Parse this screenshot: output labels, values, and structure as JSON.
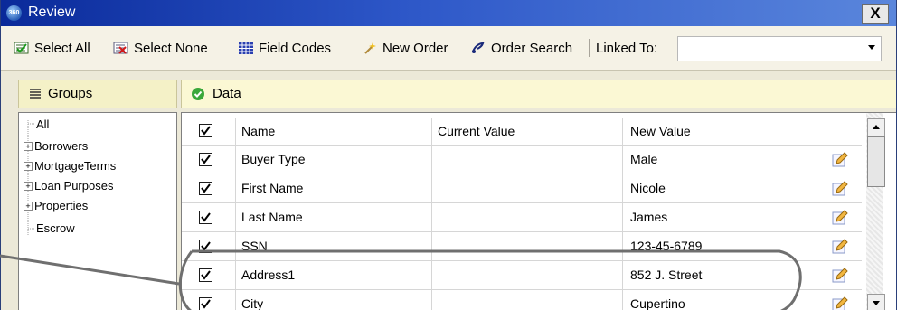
{
  "window": {
    "title": "Review",
    "close_label": "X",
    "app_icon": "360-logo-icon",
    "app_icon_text": "360"
  },
  "toolbar": {
    "select_all": "Select All",
    "select_none": "Select None",
    "field_codes": "Field Codes",
    "new_order": "New Order",
    "order_search": "Order Search",
    "linked_to": "Linked To:",
    "linked_to_value": ""
  },
  "groups": {
    "label": "Groups",
    "items": [
      {
        "label": "All",
        "expandable": false
      },
      {
        "label": "Borrowers",
        "expandable": true
      },
      {
        "label": "MortgageTerms",
        "expandable": true
      },
      {
        "label": "Loan Purposes",
        "expandable": true
      },
      {
        "label": "Properties",
        "expandable": true
      },
      {
        "label": "Escrow",
        "expandable": false
      }
    ]
  },
  "data": {
    "label": "Data",
    "columns": {
      "name": "Name",
      "current": "Current Value",
      "new": "New Value"
    },
    "header_checked": true,
    "rows": [
      {
        "checked": true,
        "name": "Buyer Type",
        "current": "",
        "new": "Male"
      },
      {
        "checked": true,
        "name": "First Name",
        "current": "",
        "new": "Nicole"
      },
      {
        "checked": true,
        "name": "Last Name",
        "current": "",
        "new": "James"
      },
      {
        "checked": true,
        "name": "SSN",
        "current": "",
        "new": "123-45-6789"
      },
      {
        "checked": true,
        "name": "Address1",
        "current": "",
        "new": "852 J. Street"
      },
      {
        "checked": true,
        "name": "City",
        "current": "",
        "new": "Cupertino"
      }
    ]
  },
  "colors": {
    "titlebar": "#0a2a9a",
    "groups_header": "#f4f1c7",
    "data_header": "#fbf8d4",
    "annotation": "#6f6f6f"
  }
}
